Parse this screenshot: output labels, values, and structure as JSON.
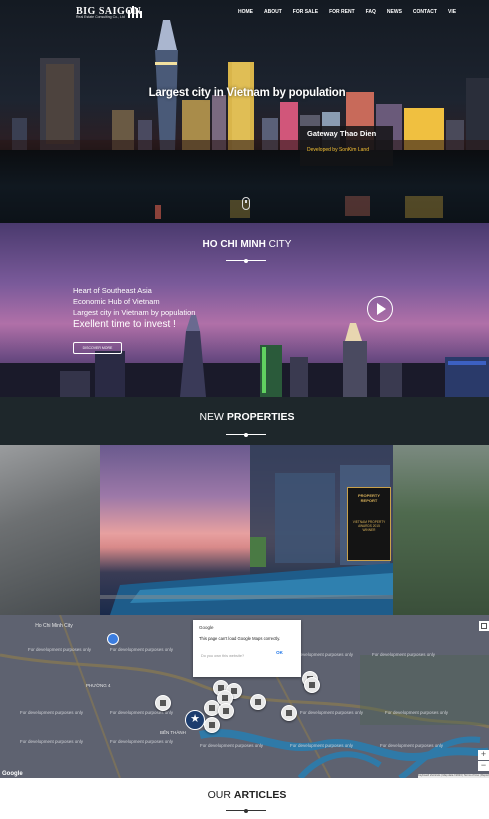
{
  "brand": {
    "name": "BIG SAIGON",
    "tagline": "Real Estate Consulting Co., Ltd"
  },
  "nav": {
    "items": [
      "HOME",
      "ABOUT",
      "FOR SALE",
      "FOR RENT",
      "FAQ",
      "NEWS",
      "CONTACT",
      "VIE"
    ]
  },
  "hero": {
    "headline": "Largest city in Vietnam by population",
    "scroll_icon": "mouse-scroll-icon"
  },
  "hcmc": {
    "title_bold": "HO CHI MINH",
    "title_light": " CITY",
    "lines": [
      "Heart of Southeast Asia",
      "Economic Hub of Vietnam",
      "Largest city in Vietnam by population"
    ],
    "highlight": "Exellent time to invest !",
    "discover_label": "DISCOVER MORE",
    "play_icon": "play-icon"
  },
  "new_properties": {
    "title_light": "NEW ",
    "title_bold": "PROPERTIES",
    "featured": {
      "name": "Gateway Thao Dien",
      "developer": "Developed by SonKim Land"
    },
    "award": {
      "line1": "PROPERTY REPORT",
      "line2": "VIETNAM PROPERTY AWARDS 2015 WINNER"
    }
  },
  "map": {
    "dialog": {
      "brand": "Google",
      "message": "This page can't load Google Maps correctly.",
      "question": "Do you own this website?",
      "ok_label": "OK"
    },
    "watermark": "For development purposes only",
    "labels": {
      "city": "Ho Chi Minh City",
      "district": "PHƯỜNG 4",
      "ben_thanh": "BẾN THÀNH"
    },
    "google_logo": "Google",
    "attribution": "Keyboard shortcuts | Map data ©2023 | Terms of Use | Report a map error",
    "zoom_in": "+",
    "zoom_out": "−"
  },
  "articles": {
    "title_light": "OUR ",
    "title_bold": "ARTICLES"
  },
  "colors": {
    "dark_band": "#1e272b",
    "caption_accent": "#f4c133",
    "map_marker_featured": "#1d3d6e"
  }
}
